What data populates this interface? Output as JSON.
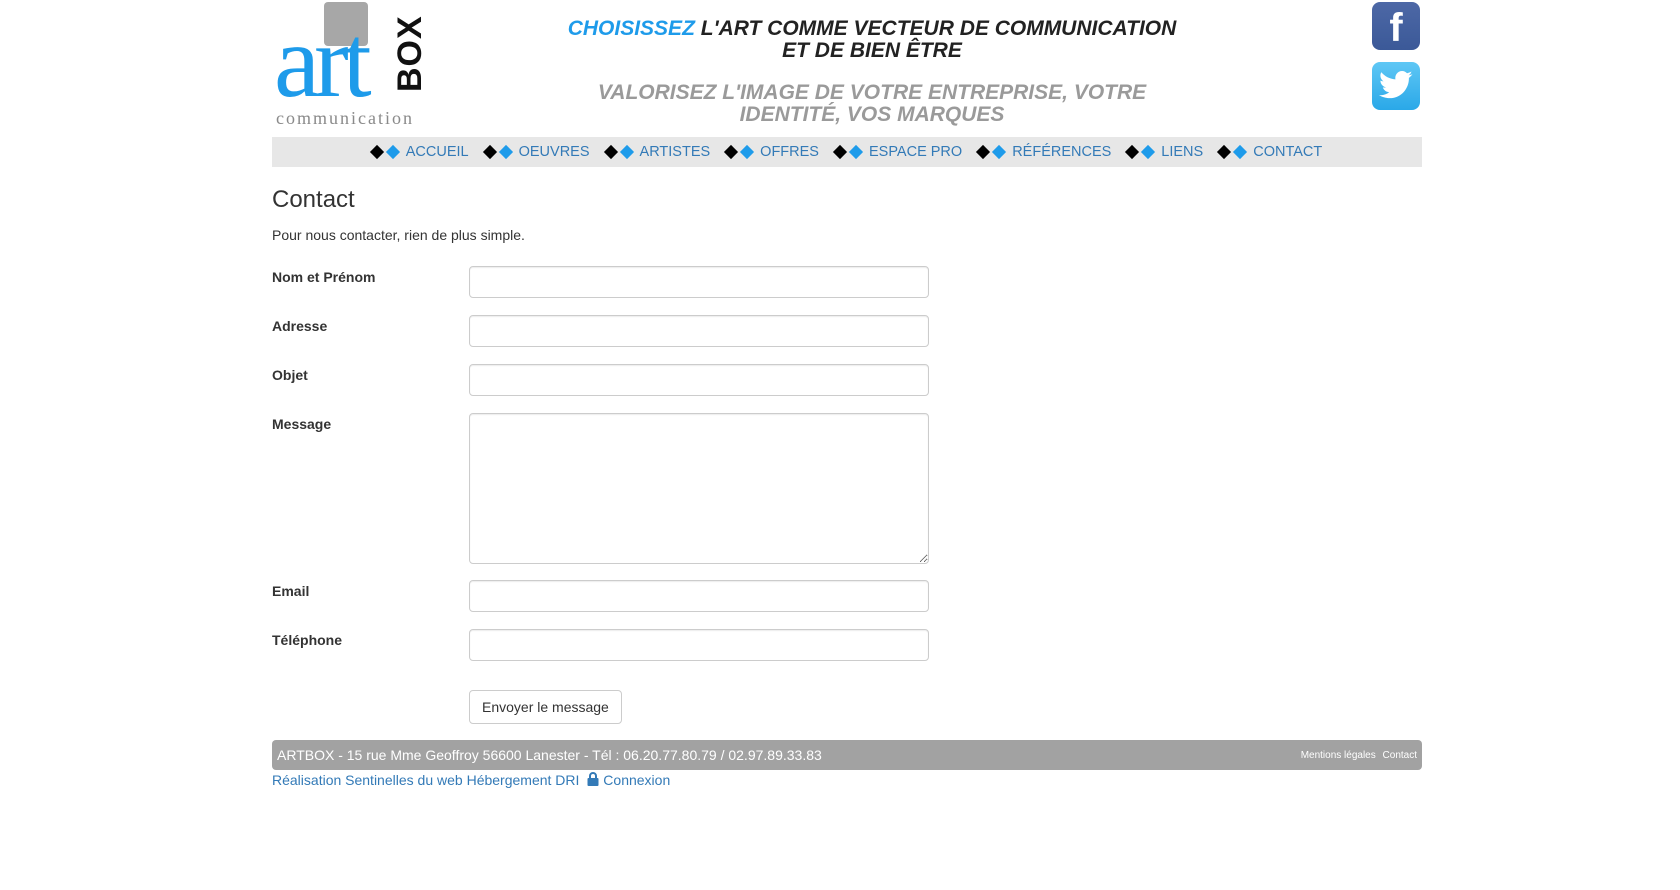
{
  "logo": {
    "art": "art",
    "box": "BOX",
    "sub": "communication"
  },
  "slogan": {
    "highlight": "CHOISISSEZ",
    "line1_rest": "L'ART COMME VECTEUR DE COMMUNICATION ET DE BIEN ÊTRE",
    "line2": "VALORISEZ L'IMAGE DE VOTRE ENTREPRISE, VOTRE IDENTITÉ, VOS MARQUES"
  },
  "social": {
    "facebook": "f"
  },
  "nav": {
    "items": [
      "ACCUEIL",
      "OEUVRES",
      "ARTISTES",
      "OFFRES",
      "ESPACE PRO",
      "RÉFÉRENCES",
      "LIENS",
      "CONTACT"
    ]
  },
  "page": {
    "title": "Contact",
    "intro": "Pour nous contacter, rien de plus simple."
  },
  "form": {
    "fields": [
      {
        "label": "Nom et Prénom",
        "value": ""
      },
      {
        "label": "Adresse",
        "value": ""
      },
      {
        "label": "Objet",
        "value": ""
      },
      {
        "label": "Message",
        "value": ""
      },
      {
        "label": "Email",
        "value": ""
      },
      {
        "label": "Téléphone",
        "value": ""
      }
    ],
    "submit": "Envoyer le message"
  },
  "footer": {
    "address": "ARTBOX - 15 rue Mme Geoffroy 56600 Lanester - Tél : 06.20.77.80.79 / 02.97.89.33.83",
    "links": [
      "Mentions légales",
      "Contact"
    ]
  },
  "credits": {
    "realisation": "Réalisation Sentinelles du web",
    "hebergement": "Hébergement DRI",
    "connexion": "Connexion"
  },
  "colors": {
    "accent": "#1e9bea",
    "link": "#337ab7",
    "footer_bg": "#a2a2a2",
    "nav_bg": "#e7e7e7"
  }
}
